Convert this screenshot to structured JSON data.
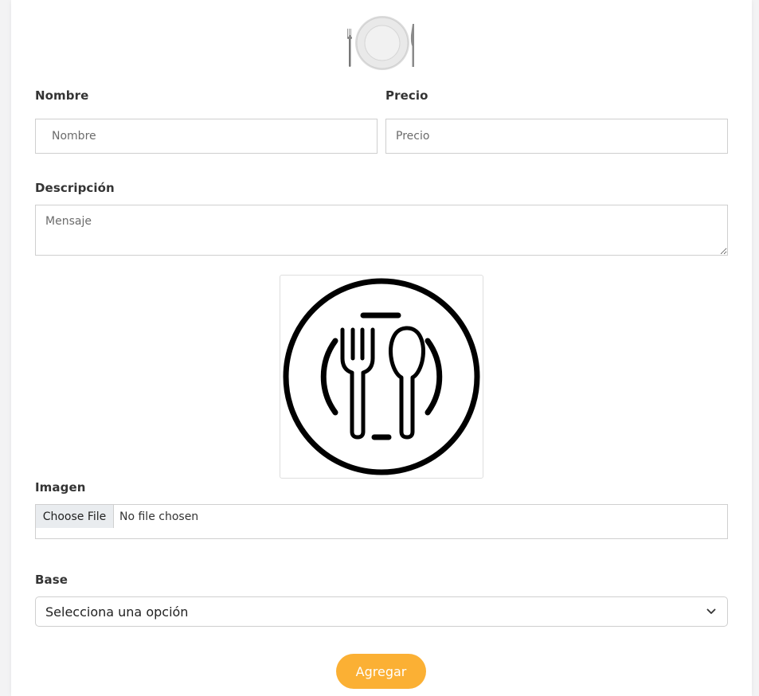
{
  "form": {
    "nombre": {
      "label": "Nombre",
      "placeholder": "Nombre",
      "value": ""
    },
    "precio": {
      "label": "Precio",
      "placeholder": "Precio",
      "value": ""
    },
    "descripcion": {
      "label": "Descripción",
      "placeholder": "Mensaje",
      "value": ""
    },
    "imagen": {
      "label": "Imagen",
      "button_label": "Choose File",
      "status": "No file chosen"
    },
    "base": {
      "label": "Base",
      "selected": "Selecciona una opción"
    },
    "submit_label": "Agregar"
  },
  "icons": {
    "logo": "plate-with-cutlery-icon",
    "preview": "plate-fork-spoon-icon",
    "select_arrow": "chevron-down-icon"
  },
  "colors": {
    "accent": "#fbb034",
    "label": "#343434",
    "border": "#cfcfcf"
  }
}
